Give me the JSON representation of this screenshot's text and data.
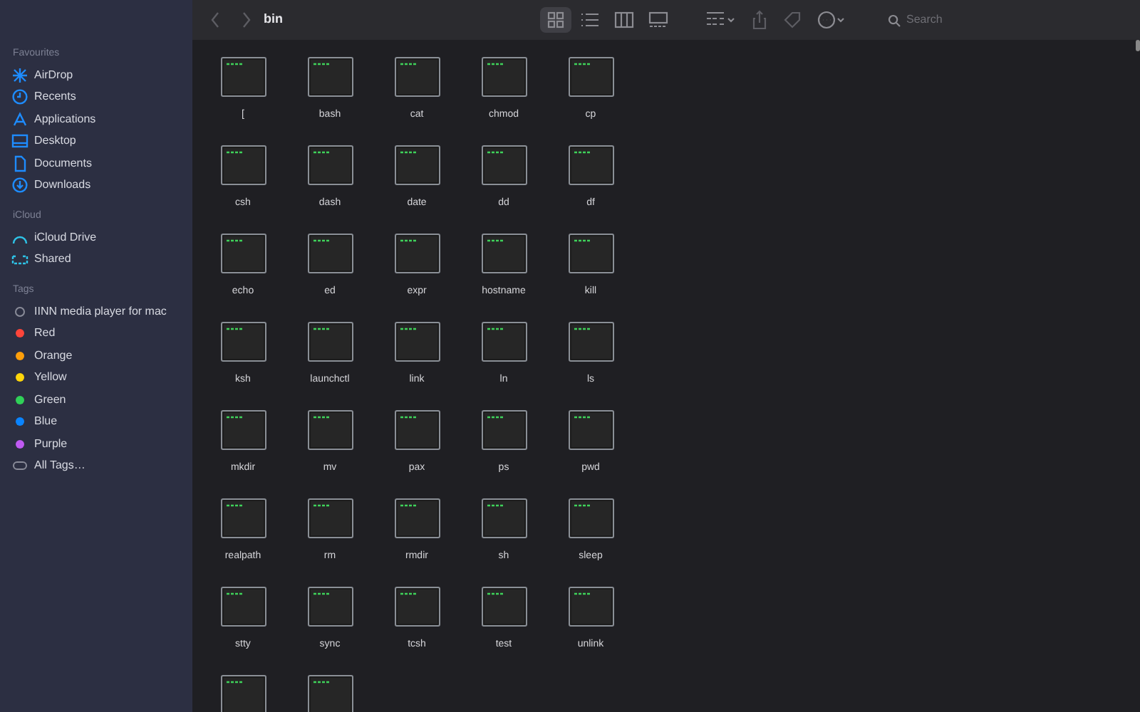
{
  "window": {
    "title": "bin"
  },
  "sidebar": {
    "sections": [
      {
        "title": "Favourites",
        "items": [
          {
            "label": "AirDrop",
            "kind": "airdrop"
          },
          {
            "label": "Recents",
            "kind": "clock"
          },
          {
            "label": "Applications",
            "kind": "apps"
          },
          {
            "label": "Desktop",
            "kind": "desktop"
          },
          {
            "label": "Documents",
            "kind": "document"
          },
          {
            "label": "Downloads",
            "kind": "download"
          }
        ]
      },
      {
        "title": "iCloud",
        "items": [
          {
            "label": "iCloud Drive",
            "kind": "cloud"
          },
          {
            "label": "Shared",
            "kind": "shared"
          }
        ]
      },
      {
        "title": "Tags",
        "items": [
          {
            "label": "IINN media player for mac",
            "kind": "tag-outline"
          },
          {
            "label": "Red",
            "kind": "tag",
            "color": "#ff453a"
          },
          {
            "label": "Orange",
            "kind": "tag",
            "color": "#ff9f0a"
          },
          {
            "label": "Yellow",
            "kind": "tag",
            "color": "#ffd60a"
          },
          {
            "label": "Green",
            "kind": "tag",
            "color": "#30d158"
          },
          {
            "label": "Blue",
            "kind": "tag",
            "color": "#0a84ff"
          },
          {
            "label": "Purple",
            "kind": "tag",
            "color": "#bf5af2"
          },
          {
            "label": "All Tags…",
            "kind": "all-tags"
          }
        ]
      }
    ]
  },
  "toolbar": {
    "view_buttons": [
      {
        "kind": "icons",
        "selected": true
      },
      {
        "kind": "list",
        "selected": false
      },
      {
        "kind": "columns",
        "selected": false
      },
      {
        "kind": "gallery",
        "selected": false
      }
    ],
    "search": {
      "placeholder": "Search"
    }
  },
  "files": [
    {
      "kind": "file",
      "name": "["
    },
    {
      "kind": "file",
      "name": "bash"
    },
    {
      "kind": "file",
      "name": "cat"
    },
    {
      "kind": "file",
      "name": "chmod"
    },
    {
      "kind": "file",
      "name": "cp"
    },
    {
      "kind": "file",
      "name": "csh"
    },
    {
      "kind": "file",
      "name": "dash"
    },
    {
      "kind": "file",
      "name": "date"
    },
    {
      "kind": "file",
      "name": "dd"
    },
    {
      "kind": "file",
      "name": "df"
    },
    {
      "kind": "file",
      "name": "echo"
    },
    {
      "kind": "file",
      "name": "ed"
    },
    {
      "kind": "file",
      "name": "expr"
    },
    {
      "kind": "file",
      "name": "hostname"
    },
    {
      "kind": "file",
      "name": "kill"
    },
    {
      "kind": "file",
      "name": "ksh"
    },
    {
      "kind": "file",
      "name": "launchctl"
    },
    {
      "kind": "file",
      "name": "link"
    },
    {
      "kind": "file",
      "name": "ln"
    },
    {
      "kind": "file",
      "name": "ls"
    },
    {
      "kind": "file",
      "name": "mkdir"
    },
    {
      "kind": "file",
      "name": "mv"
    },
    {
      "kind": "file",
      "name": "pax"
    },
    {
      "kind": "file",
      "name": "ps"
    },
    {
      "kind": "file",
      "name": "pwd"
    },
    {
      "kind": "file",
      "name": "realpath"
    },
    {
      "kind": "file",
      "name": "rm"
    },
    {
      "kind": "file",
      "name": "rmdir"
    },
    {
      "kind": "file",
      "name": "sh"
    },
    {
      "kind": "file",
      "name": "sleep"
    },
    {
      "kind": "file",
      "name": "stty"
    },
    {
      "kind": "file",
      "name": "sync"
    },
    {
      "kind": "file",
      "name": "tcsh"
    },
    {
      "kind": "file",
      "name": "test"
    },
    {
      "kind": "file",
      "name": "unlink"
    },
    {
      "kind": "cut-off"
    },
    {
      "kind": "cut-off"
    }
  ]
}
